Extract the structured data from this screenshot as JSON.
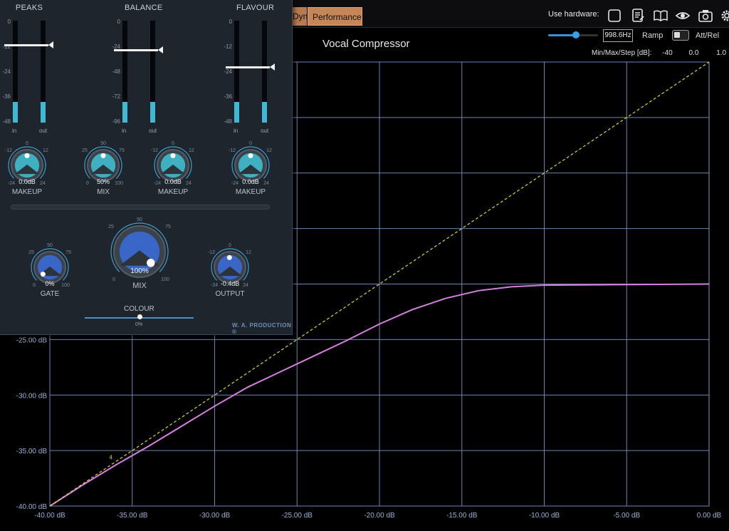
{
  "topbar": {
    "tabs": [
      {
        "label": "Dynamics"
      },
      {
        "label": "Performance"
      }
    ],
    "use_hardware_label": "Use hardware:",
    "icons": [
      "square-icon",
      "notes-icon",
      "book-icon",
      "eye-icon",
      "camera-icon",
      "gear-icon"
    ],
    "frequency": "998.6Hz",
    "ramp_label": "Ramp",
    "attrel_label": "Att/Rel",
    "slider_value": 0.55
  },
  "chart_title": "Vocal Compressor",
  "minmax": {
    "label": "Min/Max/Step [dB]:",
    "min": "-40",
    "max": "0.0",
    "step": "1.0"
  },
  "chart_data": {
    "type": "line",
    "title": "Vocal Compressor",
    "xlabel": "",
    "ylabel": "",
    "xlim": [
      -40,
      0
    ],
    "ylim": [
      -40,
      0
    ],
    "x_ticks": [
      "-40.00 dB",
      "-35.00 dB",
      "-30.00 dB",
      "-25.00 dB",
      "-20.00 dB",
      "-15.00 dB",
      "-10.00 dB",
      "-5.00 dB",
      "0.00 dB"
    ],
    "y_ticks": [
      "-25.00 dB",
      "-30.00 dB",
      "-35.00 dB",
      "-40.00 dB"
    ],
    "y_tick_values": [
      -25,
      -30,
      -35,
      -40
    ],
    "grid": true,
    "series": [
      {
        "style": "solid",
        "color": "#d77fe0",
        "x": [
          -40,
          -38,
          -36,
          -34,
          -32,
          -30,
          -28,
          -26,
          -24,
          -22,
          -20,
          -18,
          -16,
          -14,
          -12,
          -10,
          -5,
          0
        ],
        "y": [
          -40,
          -38.1,
          -36.3,
          -34.6,
          -32.8,
          -31.0,
          -29.3,
          -27.9,
          -26.5,
          -25.1,
          -23.6,
          -22.3,
          -21.3,
          -20.6,
          -20.25,
          -20.1,
          -20.05,
          -20.0
        ]
      },
      {
        "style": "dashed",
        "color": "#d8d830",
        "x": [
          -40,
          0
        ],
        "y": [
          -40,
          0
        ]
      }
    ],
    "marker": {
      "label": "4",
      "x": -36.3,
      "y": -35.6
    }
  },
  "plugin": {
    "sections": [
      {
        "title": "PEAKS",
        "scale": [
          "0",
          "-12",
          "-24",
          "-36",
          "-48"
        ],
        "in_level": 0.2,
        "out_level": 0.2,
        "fader": 0.23
      },
      {
        "title": "BALANCE",
        "scale": [
          "0",
          "-24",
          "-48",
          "-72",
          "-96"
        ],
        "in_level": 0.2,
        "out_level": 0.2,
        "fader": 0.28
      },
      {
        "title": "FLAVOUR",
        "scale": [
          "0",
          "-12",
          "-24",
          "-36",
          "-48"
        ],
        "in_level": 0.2,
        "out_level": 0.2,
        "fader": 0.45
      }
    ],
    "meter_in": "in",
    "meter_out": "out",
    "knobs_row1": [
      {
        "label": "MAKEUP",
        "value": "0.0dB",
        "ticks": [
          "-12",
          "0",
          "12",
          "-24",
          "24"
        ]
      },
      {
        "label": "MIX",
        "value": "50%",
        "ticks": [
          "25",
          "50",
          "75",
          "0",
          "100"
        ]
      },
      {
        "label": "MAKEUP",
        "value": "0.0dB",
        "ticks": [
          "-12",
          "0",
          "12",
          "-24",
          "24"
        ]
      },
      {
        "label": "MAKEUP",
        "value": "0.0dB",
        "ticks": [
          "-12",
          "0",
          "12",
          "-24",
          "24"
        ]
      }
    ],
    "gate": {
      "label": "GATE",
      "value": "0%",
      "ticks": [
        "25",
        "50",
        "75",
        "0",
        "100"
      ]
    },
    "mix": {
      "label": "MIX",
      "value": "100%",
      "ticks": [
        "25",
        "50",
        "75",
        "0",
        "100"
      ]
    },
    "output": {
      "label": "OUTPUT",
      "value": "-0.4dB",
      "ticks": [
        "-12",
        "0",
        "12",
        "-24",
        "24"
      ]
    },
    "colour": {
      "label": "COLOUR",
      "value": "0%"
    },
    "brand": "W. A. PRODUCTION ®"
  }
}
